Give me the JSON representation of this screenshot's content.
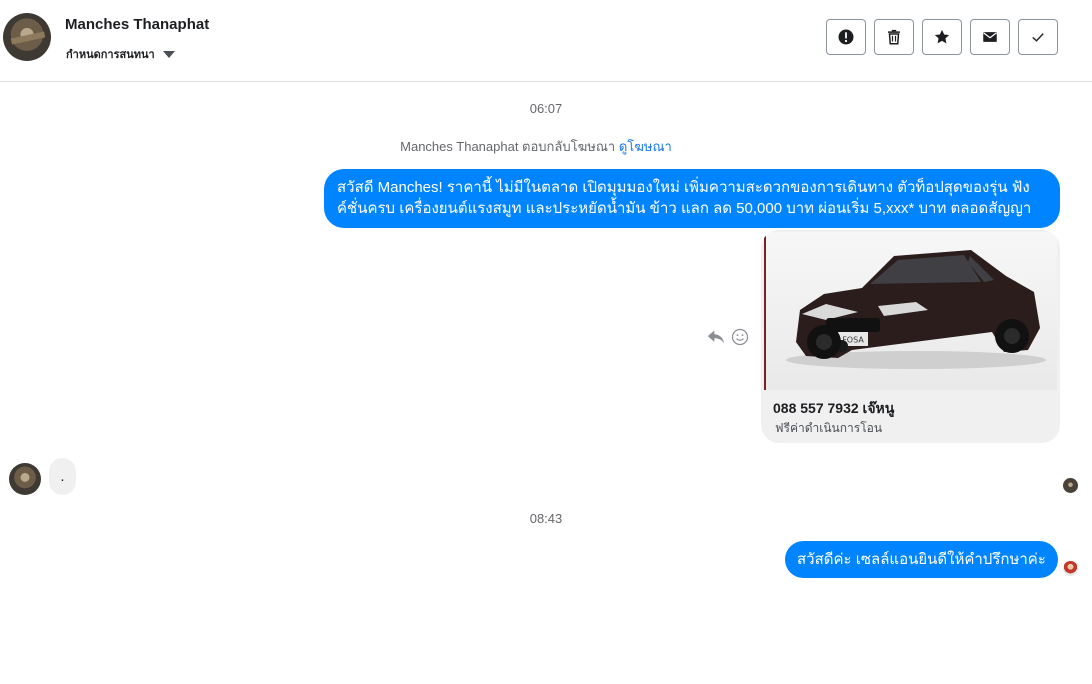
{
  "header": {
    "contact_name": "Manches Thanaphat",
    "label_select": "กำหนดการสนทนา",
    "tools": [
      {
        "name": "report",
        "icon": "alert-icon"
      },
      {
        "name": "delete",
        "icon": "trash-icon"
      },
      {
        "name": "star",
        "icon": "star-icon"
      },
      {
        "name": "mark-unread",
        "icon": "envelope-icon"
      },
      {
        "name": "done",
        "icon": "check-icon"
      }
    ]
  },
  "conversation": {
    "time_1": "06:07",
    "ad_reply": {
      "text": "Manches Thanaphat ตอบกลับโฆษณา",
      "link": "ดูโฆษณา"
    },
    "message_1": "สวัสดี Manches! ราคานี้ ไม่มีในตลาด เปิดมุมมองใหม่ เพิ่มความสะดวกของการเดินทาง ตัวท็อปสุดของรุ่น ฟังค์ชั่นครบ เครื่องยนต์แรงสมูท และประหยัดน้ำมัน ข้าว แลก ลด 50,000 บาท ผ่อนเริ่ม 5,xxx* บาท ตลอดสัญญา",
    "card": {
      "image_icon": "car-image-icon",
      "plate_text": "FOSA",
      "title": "088 557 7932 เจ๊หนู",
      "subtitle": "ฟรีค่าดำเนินการโอน"
    },
    "incoming_1": ".",
    "time_2": "08:43",
    "message_2": "สวัสดีค่ะ เซลล์แอนยินดีให้คำปรึกษาค่ะ"
  },
  "colors": {
    "outgoing_bubble": "#0084ff",
    "incoming_bubble": "#f0f0f0",
    "link": "#1877f2"
  }
}
